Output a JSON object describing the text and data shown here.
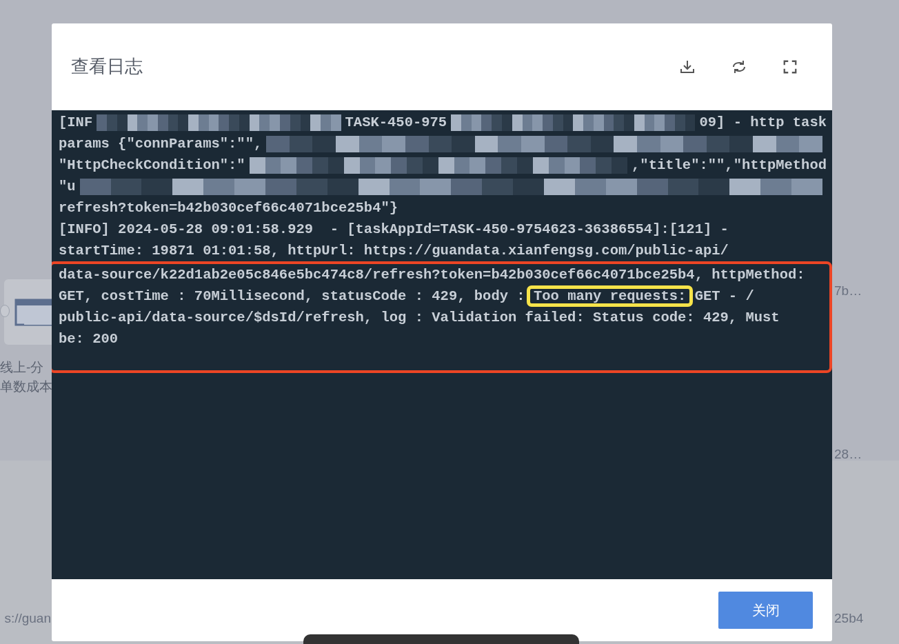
{
  "background": {
    "node_labels": [
      "线上-分",
      "单数成本"
    ],
    "right_texts": [
      "7b…",
      "28…",
      "25b4"
    ],
    "left_texts": [
      "s://guan"
    ]
  },
  "dialog": {
    "title": "查看日志",
    "log": {
      "blocks": [
        {
          "outlined": false,
          "lines": [
            [
              {
                "kind": "text",
                "text": "[INF"
              },
              {
                "kind": "mosaic"
              },
              {
                "kind": "text",
                "text": "TASK-450-975"
              },
              {
                "kind": "mosaic"
              },
              {
                "kind": "text",
                "text": "09] - http task"
              }
            ],
            [
              {
                "kind": "text",
                "text": "params {\"connParams\":\"\","
              },
              {
                "kind": "mosaic"
              }
            ],
            [
              {
                "kind": "text",
                "text": "\"HttpCheckCondition\":\""
              },
              {
                "kind": "mosaic"
              },
              {
                "kind": "text",
                "text": ",\"title\":\"\",\"httpMethod"
              }
            ],
            [
              {
                "kind": "text",
                "text": "\"u"
              },
              {
                "kind": "mosaic"
              }
            ],
            [
              {
                "kind": "text",
                "text": "refresh?token=b42b030cef66c4071bce25b4\"}"
              }
            ],
            [
              {
                "kind": "text",
                "text": "[INFO] 2024-05-28 09:01:58.929  - [taskAppId=TASK-450-9754623-36386554]:[121] -"
              }
            ],
            [
              {
                "kind": "text",
                "text": "startTime: 19871 01:01:58, httpUrl: https://guandata.xianfengsg.com/public-api/"
              }
            ]
          ]
        },
        {
          "outlined": true,
          "lines": [
            [
              {
                "kind": "text",
                "text": "data-source/k22d1ab2e05c846e5bc474c8/refresh?token=b42b030cef66c4071bce25b4, httpMethod:"
              }
            ],
            [
              {
                "kind": "text",
                "text": "GET, costTime : 70Millisecond, statusCode : 429, body : "
              },
              {
                "kind": "highlight",
                "text": "Too many requests:"
              },
              {
                "kind": "text",
                "text": " GET - /"
              }
            ],
            [
              {
                "kind": "text",
                "text": "public-api/data-source/$dsId/refresh, log : Validation failed: Status code: 429, Must"
              }
            ],
            [
              {
                "kind": "text",
                "text": "be: 200"
              }
            ]
          ]
        }
      ]
    },
    "buttons": [
      {
        "label": "关闭"
      }
    ]
  }
}
